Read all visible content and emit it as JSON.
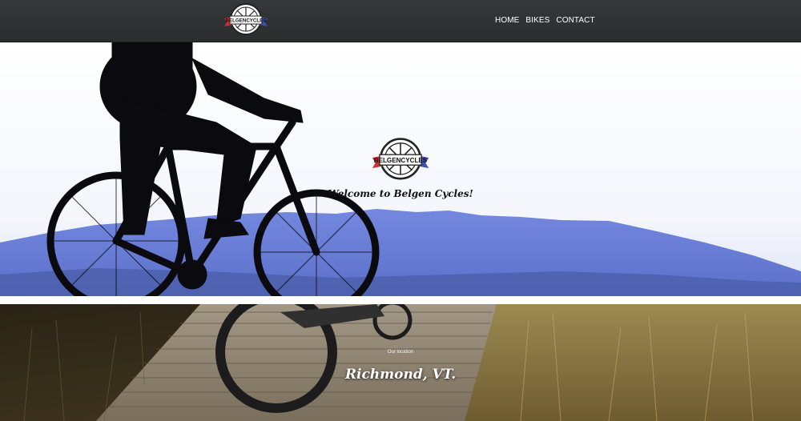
{
  "brand": {
    "name": "BELGENCYCLES",
    "colors": {
      "navbar": "#2f3132",
      "ribbon_red": "#d62e2e",
      "ribbon_blue": "#3b4fb4",
      "mountain": "#6c7fd6"
    }
  },
  "nav": {
    "items": [
      {
        "label": "HOME"
      },
      {
        "label": "BIKES"
      },
      {
        "label": "CONTACT"
      }
    ]
  },
  "hero": {
    "title": "Welcome to Belgen Cycles!",
    "image": "cyclist-silhouette-mountains"
  },
  "location": {
    "label": "Our location",
    "city": "Richmond, VT.",
    "image": "mountain-bike-boardwalk"
  }
}
